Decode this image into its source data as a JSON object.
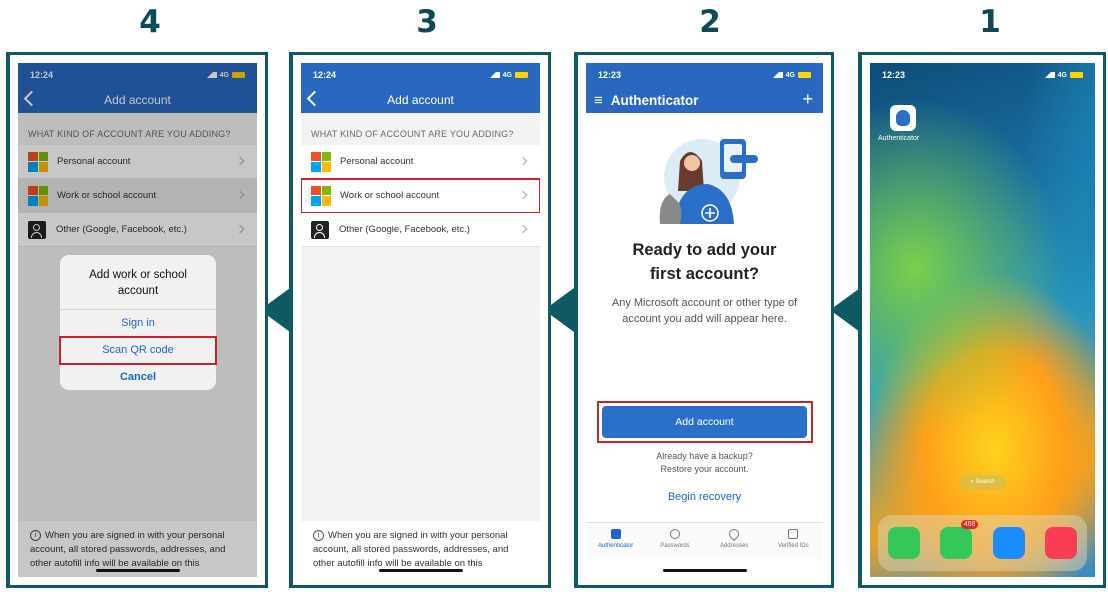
{
  "steps": [
    "4",
    "3",
    "2",
    "1"
  ],
  "colors": {
    "frame": "#0e5a63",
    "header_blue": "#2868be",
    "highlight": "#c0262c",
    "link": "#1e64c8"
  },
  "screen4": {
    "time": "12:24",
    "network": "4G",
    "header_title": "Add account",
    "section_head": "WHAT KIND OF ACCOUNT ARE YOU ADDING?",
    "rows": [
      "Personal account",
      "Work or school account",
      "Other (Google, Facebook, etc.)"
    ],
    "sheet_title": "Add work or school account",
    "sheet_options": [
      "Sign in",
      "Scan QR code",
      "Cancel"
    ],
    "note": "When you are signed in with your personal account, all stored passwords, addresses, and other autofill info will be available on this"
  },
  "screen3": {
    "time": "12:24",
    "network": "4G",
    "header_title": "Add account",
    "section_head": "WHAT KIND OF ACCOUNT ARE YOU ADDING?",
    "rows": [
      "Personal account",
      "Work or school account",
      "Other (Google, Facebook, etc.)"
    ],
    "note": "When you are signed in with your personal account, all stored passwords, addresses, and other autofill info will be available on this"
  },
  "screen2": {
    "time": "12:23",
    "network": "4G",
    "header_title": "Authenticator",
    "title": "Ready to add your first account?",
    "description": "Any Microsoft account or other type of account you add will appear here.",
    "add_button": "Add account",
    "backup_line1": "Already have a backup?",
    "backup_line2": "Restore your account.",
    "recovery_link": "Begin recovery",
    "tabs": [
      "Authenticator",
      "Passwords",
      "Addresses",
      "Verified IDs"
    ]
  },
  "screen1": {
    "time": "12:23",
    "network": "4G",
    "app_label": "Authenticator",
    "search": "Search",
    "messages_badge": "468"
  }
}
